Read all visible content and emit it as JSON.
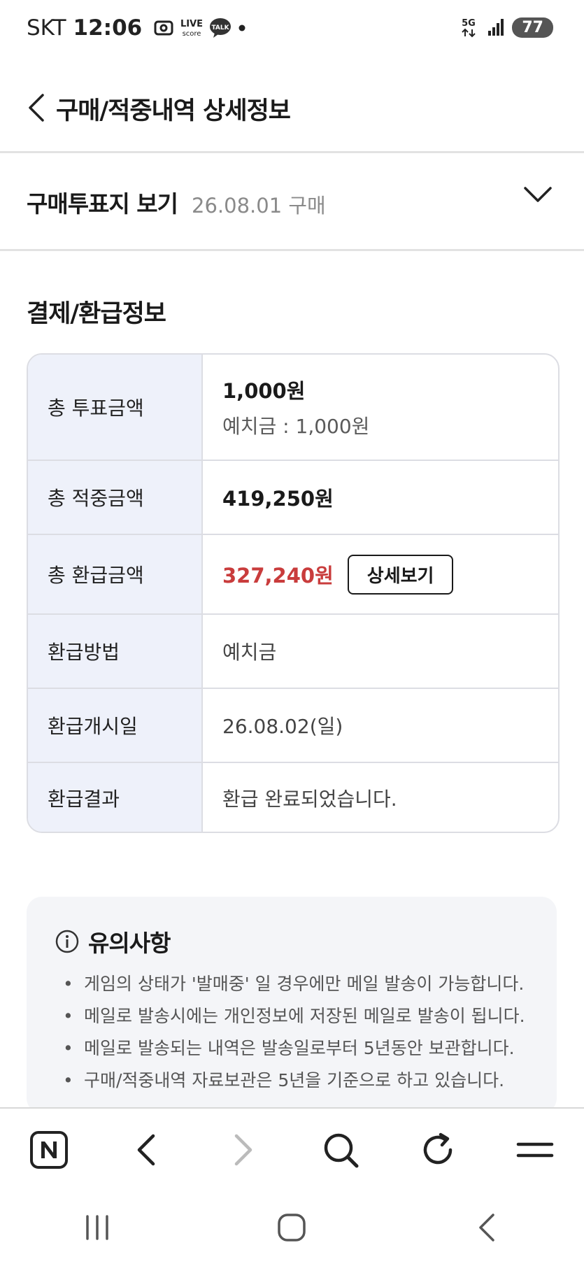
{
  "status_bar": {
    "carrier": "SKT",
    "time": "12:06",
    "live_icon_text": "LIVE",
    "score_icon_text": "score",
    "talk_icon_text": "TALK",
    "network": "5G",
    "battery": "77"
  },
  "header": {
    "title": "구매/적중내역 상세정보"
  },
  "ticket": {
    "label": "구매투표지 보기",
    "date": "26.08.01 구매"
  },
  "payment": {
    "section_title": "결제/환급정보",
    "rows": [
      {
        "label": "총 투표금액",
        "value": "1,000원",
        "sub": "예치금 : 1,000원"
      },
      {
        "label": "총 적중금액",
        "value": "419,250원"
      },
      {
        "label": "총 환급금액",
        "value": "327,240원",
        "button": "상세보기"
      },
      {
        "label": "환급방법",
        "value": "예치금"
      },
      {
        "label": "환급개시일",
        "value": "26.08.02(일)"
      },
      {
        "label": "환급결과",
        "value": "환급 완료되었습니다."
      }
    ]
  },
  "notice": {
    "title": "유의사항",
    "items": [
      "게임의 상태가 '발매중' 일 경우에만 메일 발송이 가능합니다.",
      "메일로 발송시에는 개인정보에 저장된 메일로 발송이 됩니다.",
      "메일로 발송되는 내역은 발송일로부터 5년동안 보관합니다.",
      "구매/적중내역 자료보관은 5년을 기준으로 하고 있습니다."
    ]
  },
  "colors": {
    "label_bg": "#eef1fa",
    "refund_red": "#c93c3c",
    "notice_bg": "#f4f5f8"
  }
}
